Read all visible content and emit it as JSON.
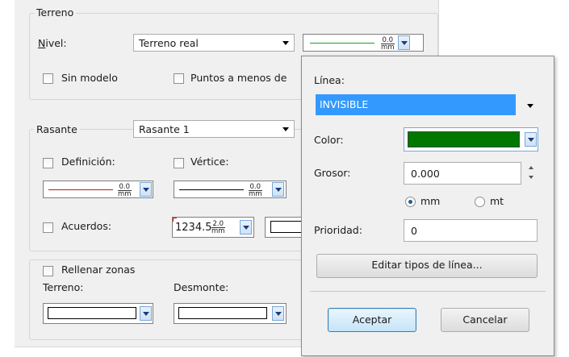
{
  "terreno": {
    "title": "Terreno",
    "nivel_label_pre": "N",
    "nivel_label_post": "ivel:",
    "nivel_value": "Terreno real",
    "line_num": "0.0",
    "line_unit": "mm",
    "sin_modelo": "Sin modelo",
    "puntos": "Puntos a menos de"
  },
  "rasante": {
    "label": "Rasante",
    "value": "Rasante 1",
    "definicion": "Definición:",
    "vertice": "Vértice:",
    "num1": "0.0",
    "unit1": "mm",
    "num2": "0.0",
    "unit2": "mm",
    "acuerdos": "Acuerdos:",
    "acuerdos_value": "1234.5",
    "acuerdos_num": "2.0",
    "acuerdos_unit": "mm"
  },
  "rellenar": {
    "title": "Rellenar zonas",
    "terreno": "Terreno:",
    "desmonte": "Desmonte:"
  },
  "popup": {
    "linea_label": "Línea:",
    "linea_value": "INVISIBLE",
    "color_label": "Color:",
    "color_value": "#007800",
    "grosor_label": "Grosor:",
    "grosor_value": "0.000",
    "unit_mm": "mm",
    "unit_mt": "mt",
    "prioridad_label": "Prioridad:",
    "prioridad_value": "0",
    "editar_button": "Editar tipos de línea...",
    "aceptar_button": "Aceptar",
    "cancelar_button": "Cancelar"
  }
}
